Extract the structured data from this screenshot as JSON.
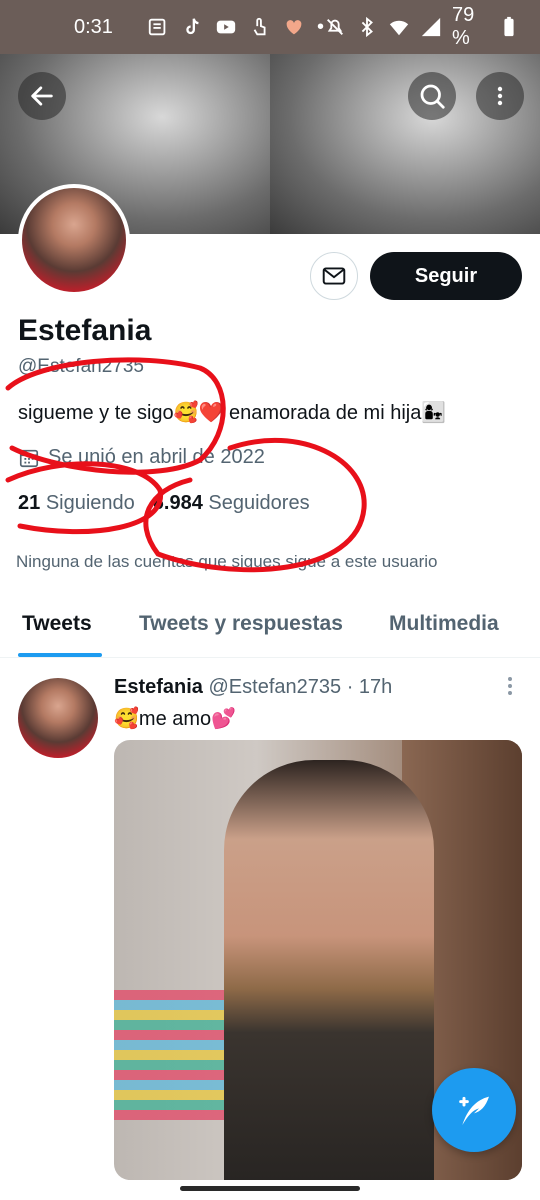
{
  "status_bar": {
    "time": "0:31",
    "battery": "79 %"
  },
  "profile": {
    "name": "Estefania",
    "handle": "@Estefan2735",
    "bio": "sigueme y te sigo🥰❤️ enamorada de mi hija👩‍👧",
    "joined": "Se unió en abril de 2022",
    "following_count": "21",
    "following_label": "Siguiendo",
    "followers_count": "6.984",
    "followers_label": "Seguidores",
    "mutual": "Ninguna de las cuentas que sigues sigue a este usuario",
    "follow_button": "Seguir"
  },
  "tabs": [
    {
      "label": "Tweets"
    },
    {
      "label": "Tweets y respuestas"
    },
    {
      "label": "Multimedia"
    }
  ],
  "tweet": {
    "author": "Estefania",
    "handle": "@Estefan2735",
    "dot": "·",
    "time": "17h",
    "text": "🥰me amo💕"
  },
  "colors": {
    "accent": "#1d9bf0",
    "annotation_red": "#e8101a"
  },
  "icons": [
    "back-arrow-icon",
    "search-icon",
    "more-vertical-icon",
    "mail-icon",
    "calendar-icon",
    "compose-tweet-icon"
  ]
}
